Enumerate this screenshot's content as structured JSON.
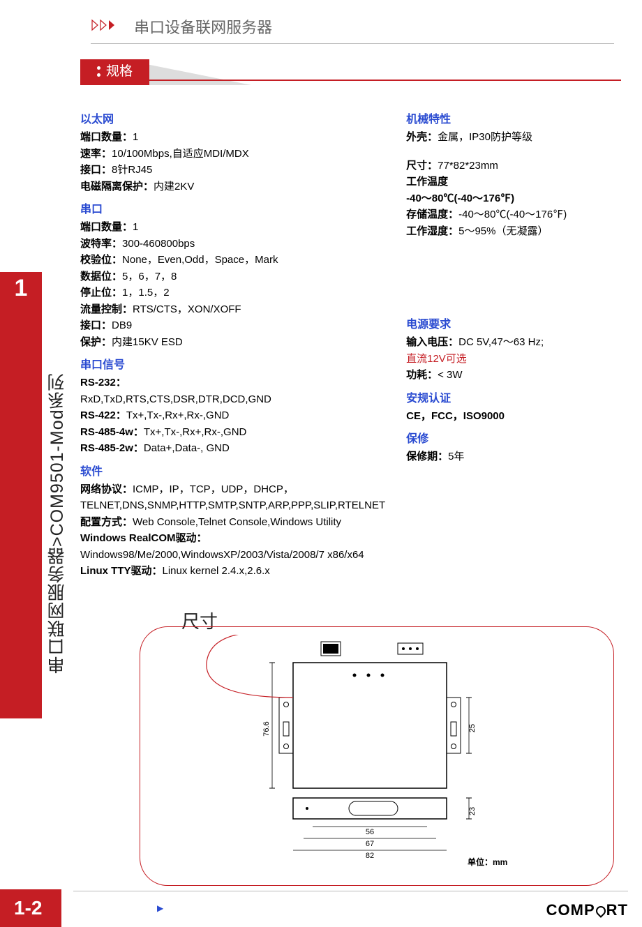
{
  "header": {
    "title": "串口设备联网服务器"
  },
  "sidebar": {
    "chapter_number": "1",
    "vertical_title": "串口联网服务器>COM9501-Mod系列"
  },
  "spec_tab": "规格",
  "left_col": {
    "ethernet": {
      "head": "以太网",
      "port_count_lab": "端口数量：",
      "port_count_val": "1",
      "speed_lab": "速率：",
      "speed_val": "10/100Mbps,自适应MDI/MDX",
      "iface_lab": "接口：",
      "iface_val": "8针RJ45",
      "emi_lab": "电磁隔离保护：",
      "emi_val": "内建2KV"
    },
    "serial": {
      "head": "串口",
      "port_count_lab": "端口数量：",
      "port_count_val": "1",
      "baud_lab": "波特率：",
      "baud_val": "300-460800bps",
      "parity_lab": "校验位：",
      "parity_val": "None，Even,Odd，Space，Mark",
      "data_lab": "数据位：",
      "data_val": "5，6，7，8",
      "stop_lab": "停止位：",
      "stop_val": "1，1.5，2",
      "flow_lab": "流量控制：",
      "flow_val": "RTS/CTS，XON/XOFF",
      "iface_lab": "接口：",
      "iface_val": "DB9",
      "prot_lab": "保护：",
      "prot_val": "内建15KV ESD"
    },
    "signals": {
      "head": "串口信号",
      "rs232_lab": "RS-232：",
      "rs232_val": "RxD,TxD,RTS,CTS,DSR,DTR,DCD,GND",
      "rs422_lab": "RS-422：",
      "rs422_val": "Tx+,Tx-,Rx+,Rx-,GND",
      "rs485_4w_lab": "RS-485-4w：",
      "rs485_4w_val": "Tx+,Tx-,Rx+,Rx-,GND",
      "rs485_2w_lab": "RS-485-2w：",
      "rs485_2w_val": "Data+,Data-,  GND"
    },
    "software": {
      "head": "软件",
      "proto_lab": "网络协议：",
      "proto_val": "ICMP，IP，TCP，UDP，DHCP，",
      "proto_val2": "TELNET,DNS,SNMP,HTTP,SMTP,SNTP,ARP,PPP,SLIP,RTELNET",
      "config_lab": "配置方式：",
      "config_val": "Web Console,Telnet Console,Windows Utility",
      "win_lab": "Windows RealCOM驱动：",
      "win_val": "Windows98/Me/2000,WindowsXP/2003/Vista/2008/7 x86/x64",
      "linux_lab": "Linux TTY驱动：",
      "linux_val": "Linux kernel 2.4.x,2.6.x"
    }
  },
  "right_col": {
    "mech": {
      "head": "机械特性",
      "case_lab": "外壳：",
      "case_val": "金属，IP30防护等级",
      "size_lab": "尺寸：",
      "size_val": "77*82*23mm",
      "optemp_lab": "工作温度",
      "optemp_val": "-40～80℃(-40～176℉)",
      "storetemp_lab": "存储温度：",
      "storetemp_val": "-40～80℃(-40～176℉)",
      "humid_lab": "工作湿度：",
      "humid_val": "5～95%（无凝露）"
    },
    "power": {
      "head": "电源要求",
      "vin_lab": "输入电压：",
      "vin_val": "DC 5V,47～63 Hz;",
      "vopt": "直流12V可选",
      "cons_lab": "功耗：",
      "cons_val": "< 3W"
    },
    "cert": {
      "head": "安规认证",
      "val": "CE，FCC，ISO9000"
    },
    "warranty": {
      "head": "保修",
      "lab": "保修期：",
      "val": "5年"
    }
  },
  "dimensions": {
    "title": "尺寸",
    "h_label": "76.6",
    "h2_label": "25",
    "h3_label": "23",
    "w1": "56",
    "w2": "67",
    "w3": "82",
    "unit": "单位：mm"
  },
  "footer": {
    "page": "1-2",
    "brand_pre": "COMP",
    "brand_post": "RT"
  }
}
